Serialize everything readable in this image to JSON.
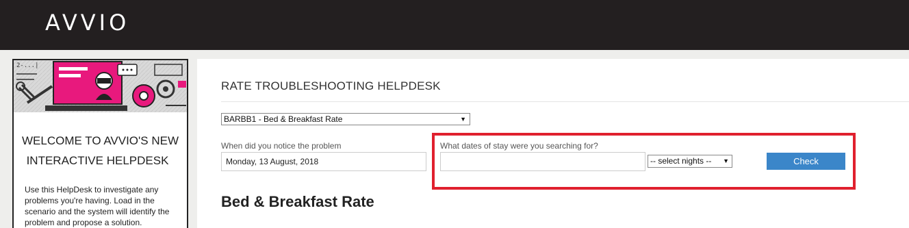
{
  "brand": {
    "logo": "AVVIO"
  },
  "sidebar": {
    "welcome_line1": "WELCOME TO AVVIO'S NEW",
    "welcome_line2": "INTERACTIVE HELPDESK",
    "intro": "Use this HelpDesk to investigate any problems you're having. Load in the scenario and the system will identify the problem and propose a solution."
  },
  "main": {
    "title": "RATE TROUBLESHOOTING HELPDESK",
    "rate_select": {
      "value": "BARBB1 - Bed & Breakfast Rate"
    },
    "notice": {
      "label": "When did you notice the problem",
      "value": "Monday, 13 August, 2018"
    },
    "stay": {
      "label": "What dates of stay were you searching for?",
      "value": ""
    },
    "nights_select": {
      "value": "-- select nights --"
    },
    "check_button": "Check",
    "section_heading": "Bed & Breakfast Rate"
  },
  "colors": {
    "accent": "#3b86c9",
    "highlight": "#e0202e",
    "topbar": "#231f20",
    "illustration_pink": "#e8197d"
  }
}
